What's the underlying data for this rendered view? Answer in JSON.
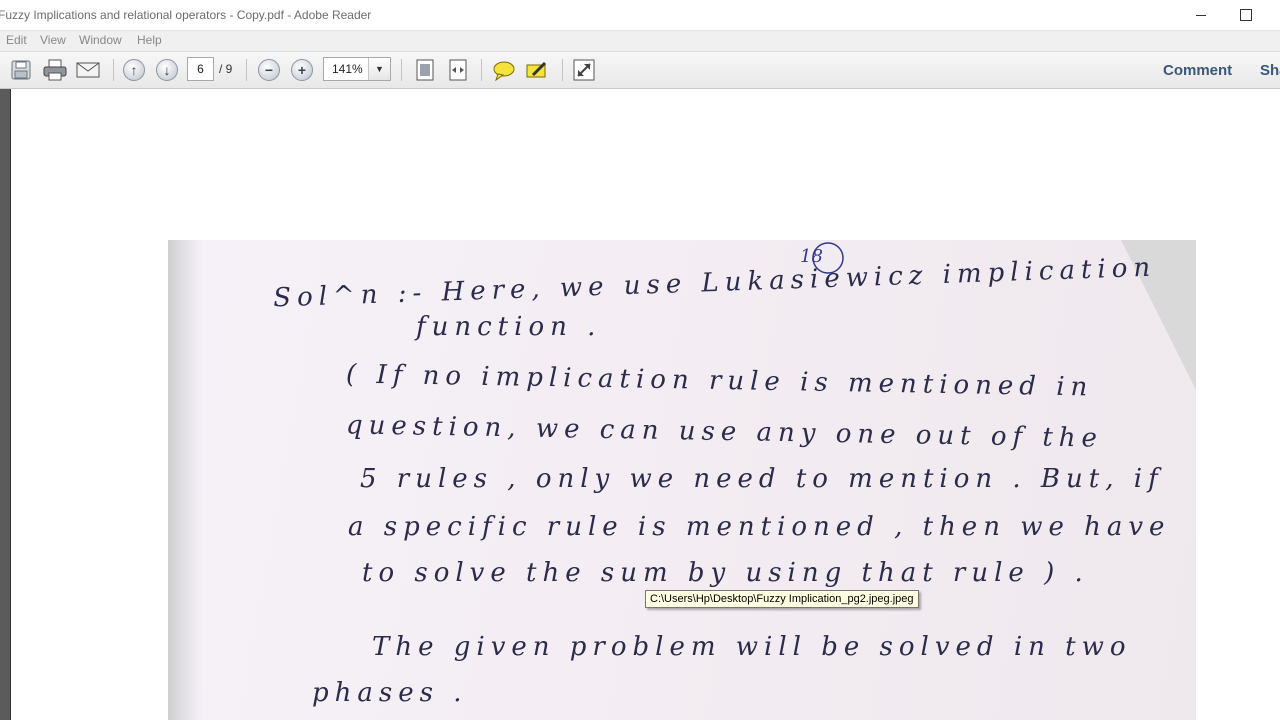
{
  "window": {
    "title": "Fuzzy Implications and relational operators - Copy.pdf - Adobe Reader"
  },
  "menu": {
    "items": [
      "Edit",
      "View",
      "Window",
      "Help"
    ]
  },
  "toolbar": {
    "page_current": "6",
    "page_total": "/ 9",
    "zoom": "141%",
    "comment_label": "Comment",
    "share_label": "Sha"
  },
  "icons": {
    "save": "save-icon",
    "print": "print-icon",
    "email": "email-icon",
    "prev_page": "arrow-up-icon",
    "next_page": "arrow-down-icon",
    "zoom_out": "minus-icon",
    "zoom_in": "plus-icon",
    "fit_page": "fit-page-icon",
    "fit_width": "fit-width-icon",
    "sticky_note": "comment-bubble-icon",
    "highlight": "highlight-pen-icon",
    "full_screen": "expand-icon"
  },
  "document": {
    "page_number_mark": "18",
    "lines": [
      "Sol^n :-   Here, we use Lukasiewicz implication",
      "function .",
      "( If no implication rule is mentioned in",
      "question, we can use any one out of the",
      "5 rules , only we need to mention . But, if",
      "a specific rule is mentioned , then we have",
      "to solve the sum by using that rule ) .",
      "The given problem will be solved in two",
      "phases ."
    ]
  },
  "tooltip": {
    "text": "C:\\Users\\Hp\\Desktop\\Fuzzy Implication_pg2.jpeg.jpeg"
  },
  "colors": {
    "ink": "#2b2b4a",
    "paper": "#f6f1f8",
    "accent_text": "#3c5878",
    "tooltip_bg": "#ffffe1"
  }
}
